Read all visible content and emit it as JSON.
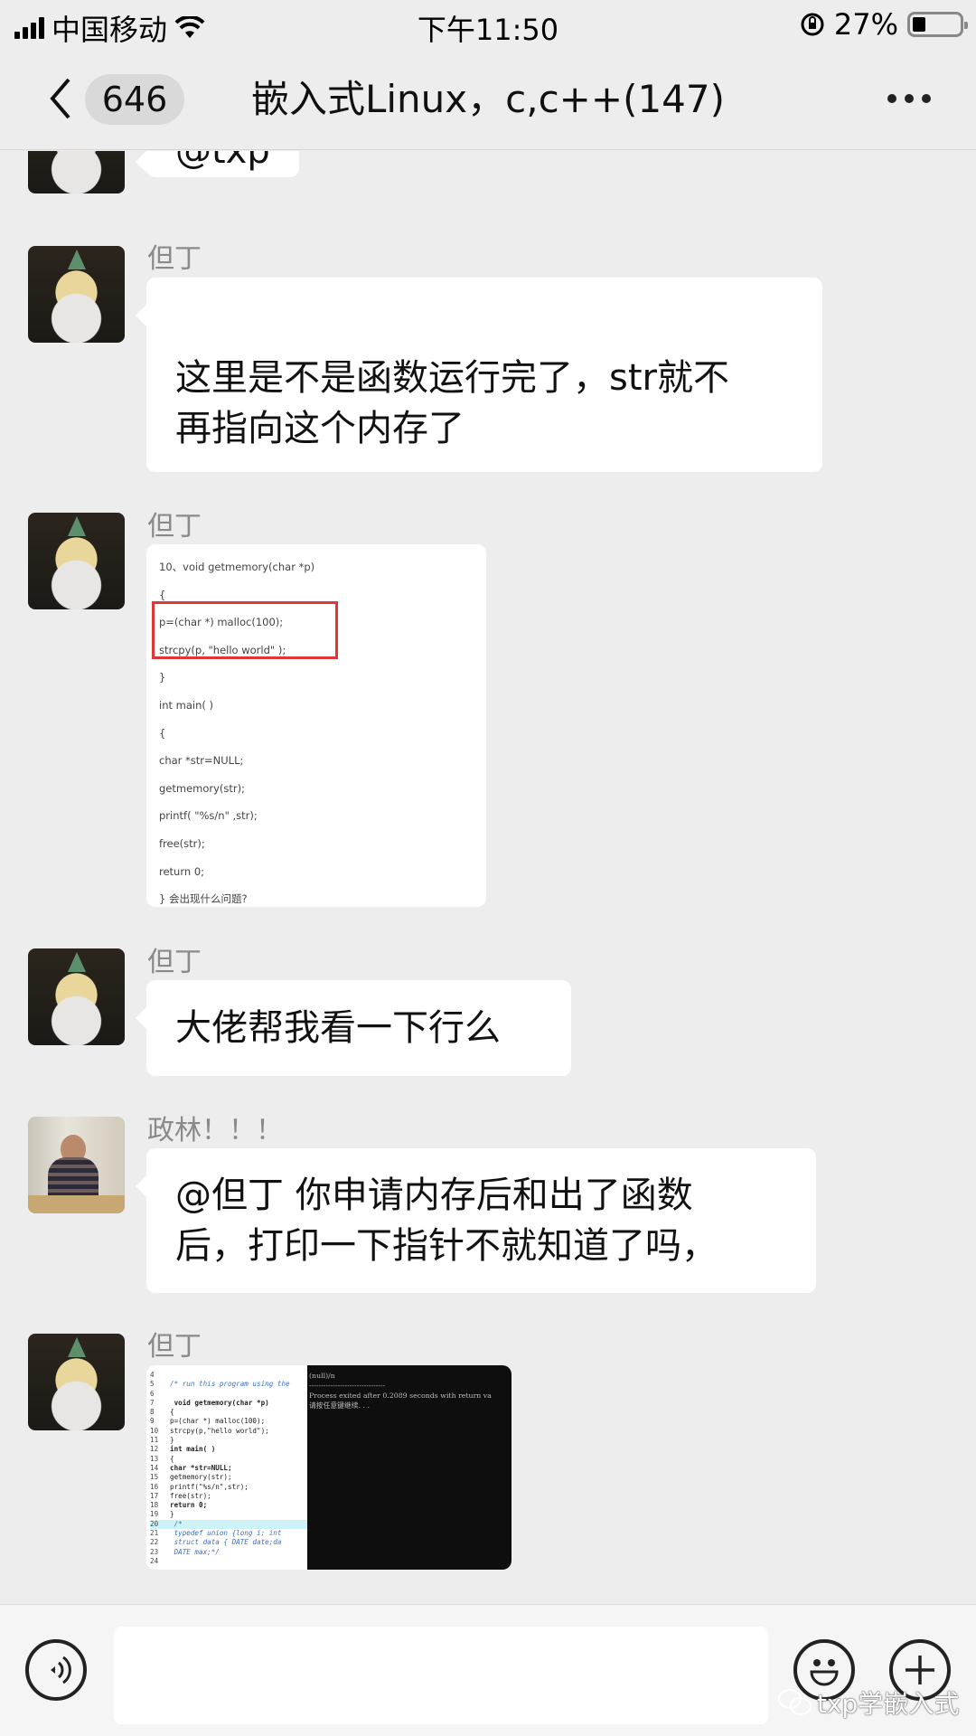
{
  "status_bar": {
    "carrier": "中国移动",
    "time": "下午11:50",
    "battery_percent": "27%",
    "battery_level": 0.27,
    "icons": [
      "signal-icon",
      "wifi-icon",
      "rotation-lock-icon",
      "battery-icon"
    ]
  },
  "nav": {
    "unread_count": "646",
    "title": "嵌入式Linux，c,c++(147)",
    "back_icon": "chevron-left-icon",
    "more_icon": "more-dots-icon"
  },
  "messages": [
    {
      "type": "text",
      "sender": "",
      "avatar": "cat-pineapple",
      "text": "@txp"
    },
    {
      "type": "text",
      "sender": "但丁",
      "avatar": "cat-pineapple",
      "text_lines": [
        "这里是不是函数运行完了，str就不",
        "再指向这个内存了"
      ]
    },
    {
      "type": "image",
      "sender": "但丁",
      "avatar": "cat-pineapple",
      "description": "code question screenshot",
      "code_lines": [
        "10、void getmemory(char *p)",
        "{",
        "p=(char *) malloc(100);",
        "strcpy(p, \"hello world\" );",
        "}",
        "int main( )",
        "{",
        "char *str=NULL;",
        "getmemory(str);",
        "printf( \"%s/n\" ,str);",
        "free(str);",
        "return 0;",
        "} 会出现什么问题?"
      ]
    },
    {
      "type": "text",
      "sender": "但丁",
      "avatar": "cat-pineapple",
      "text": "大佬帮我看一下行么"
    },
    {
      "type": "text",
      "sender": "政林！！！",
      "avatar": "person-photo",
      "text_lines": [
        "@但丁 你申请内存后和出了函数",
        "后，打印一下指针不就知道了吗，"
      ]
    },
    {
      "type": "image",
      "sender": "但丁",
      "avatar": "cat-pineapple",
      "description": "IDE and console screenshot",
      "editor_lines": [
        {
          "n": "4",
          "t": ""
        },
        {
          "n": "5",
          "t": "/* run this program using the"
        },
        {
          "n": "6",
          "t": ""
        },
        {
          "n": "7",
          "t": "  void getmemory(char *p)"
        },
        {
          "n": "8",
          "t": "{"
        },
        {
          "n": "9",
          "t": "p=(char *) malloc(100);"
        },
        {
          "n": "10",
          "t": "strcpy(p,\"hello world\");"
        },
        {
          "n": "11",
          "t": "}"
        },
        {
          "n": "12",
          "t": "int main( )"
        },
        {
          "n": "13",
          "t": "{"
        },
        {
          "n": "14",
          "t": "char *str=NULL;"
        },
        {
          "n": "15",
          "t": "getmemory(str);"
        },
        {
          "n": "16",
          "t": "printf(\"%s/n\",str);"
        },
        {
          "n": "17",
          "t": "free(str);"
        },
        {
          "n": "18",
          "t": "return 0;"
        },
        {
          "n": "19",
          "t": "}"
        },
        {
          "n": "20",
          "t": "    /*"
        },
        {
          "n": "21",
          "t": "    typedef union {long i; int"
        },
        {
          "n": "22",
          "t": "    struct data { DATE date;da"
        },
        {
          "n": "23",
          "t": "    DATE max;*/"
        },
        {
          "n": "24",
          "t": ""
        }
      ],
      "console_lines": [
        "(null)/n",
        "--------------------------------",
        "Process exited after 0.2089 seconds with return va",
        "请按任意键继续. . ."
      ]
    }
  ],
  "input_bar": {
    "voice_icon": "voice-icon",
    "text_value": "",
    "emoji_icon": "emoji-icon",
    "plus_icon": "plus-icon",
    "watermark": "txp学嵌入式"
  },
  "colors": {
    "background": "#ededed",
    "bubble": "#ffffff",
    "highlight_box": "#e03636"
  }
}
